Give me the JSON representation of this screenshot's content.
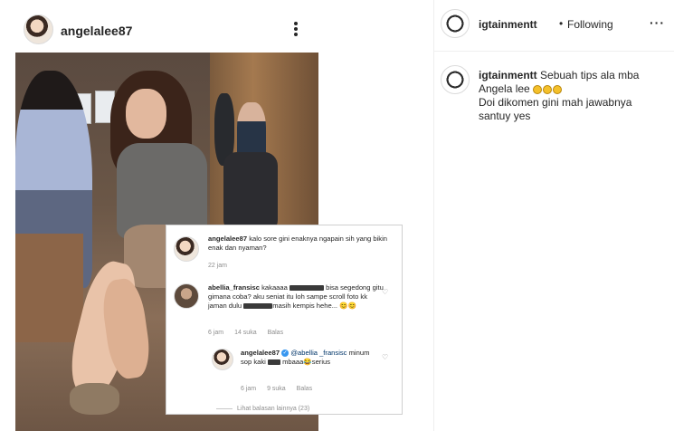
{
  "left_post": {
    "username": "angelalee87",
    "icons": {
      "avatar": "profile-avatar",
      "more": "more-options-icon"
    }
  },
  "comments_overlay": {
    "comments": [
      {
        "username": "angelalee87",
        "text": "kalo sore gini enaknya ngapain sih yang bikin enak dan nyaman?",
        "time": "22 jam"
      },
      {
        "username": "abellia_fransisc",
        "text_part1": "kakaaaa",
        "text_part2": "bisa segedong gitu gimana coba? aku seniat itu loh sampe scroll foto kk jaman dulu",
        "text_part3": "masih kempis hehe...",
        "emoji": "😊😊",
        "time": "6 jam",
        "likes": "14 suka",
        "reply": "Balas"
      },
      {
        "username": "angelalee87",
        "mention": "@abellia _fransisc",
        "text_part1": "minum sop kaki",
        "text_part2": "mbaaa😂serius",
        "time": "6 jam",
        "likes": "9 suka",
        "reply": "Balas"
      }
    ],
    "more_replies": "Lihat balasan lainnya (23)"
  },
  "right_panel": {
    "username": "igtainmentt",
    "separator": "•",
    "follow_status": "Following",
    "more": "···",
    "caption_username": "igtainmentt",
    "caption_line1": "Sebuah tips ala mba Angela lee",
    "caption_line2": "Doi dikomen gini mah jawabnya santuy yes",
    "caption_emoji_count": 3,
    "icons": {
      "emoji": "laughing-face-emoji"
    }
  }
}
